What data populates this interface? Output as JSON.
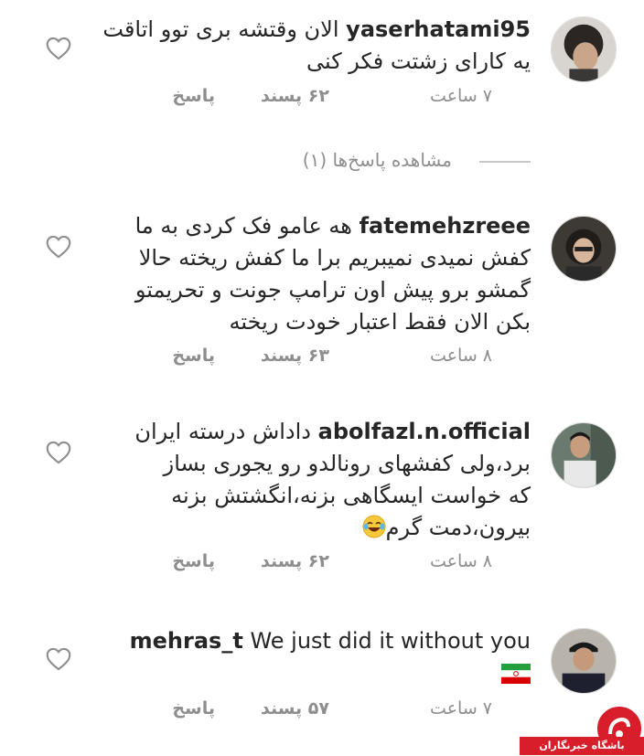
{
  "comments": [
    {
      "username": "yaserhatami95",
      "lines": [
        "الان وقتشه بری توو اتاقت",
        "یه کارای زشتت فکر کنی"
      ],
      "time": "۷ ساعت",
      "likes": "۶۲ پسند",
      "reply": "پاسخ"
    },
    {
      "username": "fatemehzreee",
      "lines": [
        "هه عامو فک کردی به ما",
        "کفش نمیدی نمیبریم برا ما کفش ریخته حالا",
        "گمشو برو پیش اون ترامپ جونت و تحریمتو",
        "بکن الان فقط اعتبار خودت ریخته"
      ],
      "time": "۸ ساعت",
      "likes": "۶۳ پسند",
      "reply": "پاسخ"
    },
    {
      "username": "abolfazl.n.official",
      "lines": [
        "داداش درسته ایران",
        "برد،ولی کفشهای رونالدو رو یجوری بساز",
        "که خواست ایسگاهی بزنه،انگشتش بزنه",
        "بیرون،دمت گرم"
      ],
      "time": "۸ ساعت",
      "likes": "۶۲ پسند",
      "reply": "پاسخ"
    },
    {
      "username": "mehras_t",
      "lines": [
        "We just did it without you"
      ],
      "time": "۷ ساعت",
      "likes": "۵۷ پسند",
      "reply": "پاسخ"
    }
  ],
  "view_replies": "مشاهده پاسخ‌ها (۱)",
  "watermark": "باشگاه خبرنگاران",
  "icons": {
    "like": "heart-outline-icon",
    "emoji": "laughing-tears-emoji",
    "flag": "iran-flag"
  },
  "colors": {
    "text": "#262626",
    "muted": "#8e8e8e",
    "watermark": "#d81e2a"
  }
}
